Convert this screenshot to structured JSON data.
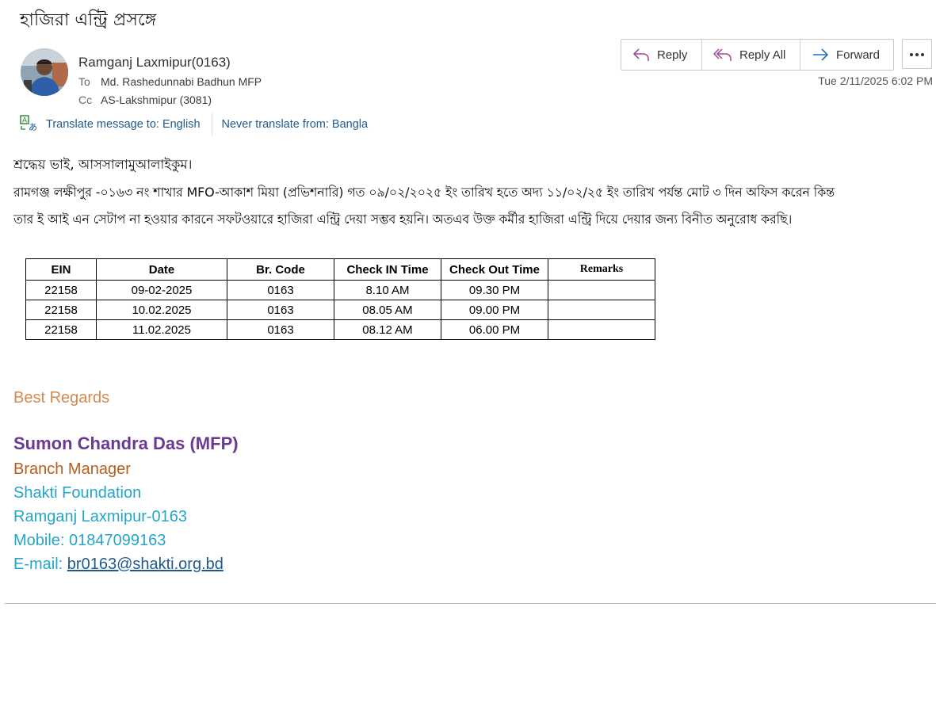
{
  "email": {
    "subject": "হাজিরা এন্ট্রি প্রসঙ্গে",
    "sender": "Ramganj Laxmipur(0163)",
    "to_label": "To",
    "to": "Md. Rashedunnabi Badhun MFP",
    "cc_label": "Cc",
    "cc": "AS-Lakshmipur (3081)",
    "datetime": "Tue 2/11/2025 6:02 PM"
  },
  "actions": {
    "reply": "Reply",
    "reply_all": "Reply All",
    "forward": "Forward",
    "more_icon": "ellipsis-icon"
  },
  "translate": {
    "icon": "translate-icon",
    "translate_link": "Translate message to: English",
    "never_link": "Never translate from: Bangla"
  },
  "body": {
    "greeting": "শ্রদ্ধেয় ভাই, আসসালামুআলাইকুম।",
    "line1": "রামগঞ্জ লক্ষীপুর -০১৬৩ নং শাখার  MFO-আকাশ  মিয়া (প্রভিশনারি)  গত  ০৯/০২/২০২৫ ইং  তারিখ হতে  অদ্য ১১/০২/২৫ ইং তারিখ পর্যন্ত মোট  ৩ দিন অফিস করেন কিন্ত",
    "line2": "তার ই আই এন সেটাপ না হওয়ার কারনে সফটওয়ারে হাজিরা এন্ট্রি দেয়া সম্ভব হয়নি। অতএব  উক্ত কর্মীর হাজিরা এন্ট্রি দিয়ে দেয়ার জন্য বিনীত অনুরোধ করছি।"
  },
  "table": {
    "headers": [
      "EIN",
      "Date",
      "Br. Code",
      "Check IN Time",
      "Check Out Time",
      "Remarks"
    ],
    "rows": [
      [
        "22158",
        "09-02-2025",
        "0163",
        "8.10 AM",
        "09.30 PM",
        ""
      ],
      [
        "22158",
        "10.02.2025",
        "0163",
        "08.05 AM",
        "09.00 PM",
        ""
      ],
      [
        "22158",
        "11.02.2025",
        "0163",
        "08.12 AM",
        "06.00 PM",
        ""
      ]
    ]
  },
  "signature": {
    "regards": "Best Regards",
    "name": "Sumon Chandra Das (MFP)",
    "title": "Branch Manager",
    "org": "Shakti Foundation",
    "branch": "Ramganj Laxmipur-0163",
    "mobile": "Mobile: 01847099163",
    "email_label": "E-mail: ",
    "email": "br0163@shakti.org.bd"
  },
  "colors": {
    "regards": "#d38a4f",
    "name": "#6a3a93",
    "title": "#b65f1f",
    "contact": "#25a6c9",
    "link": "#1f5a8c"
  }
}
